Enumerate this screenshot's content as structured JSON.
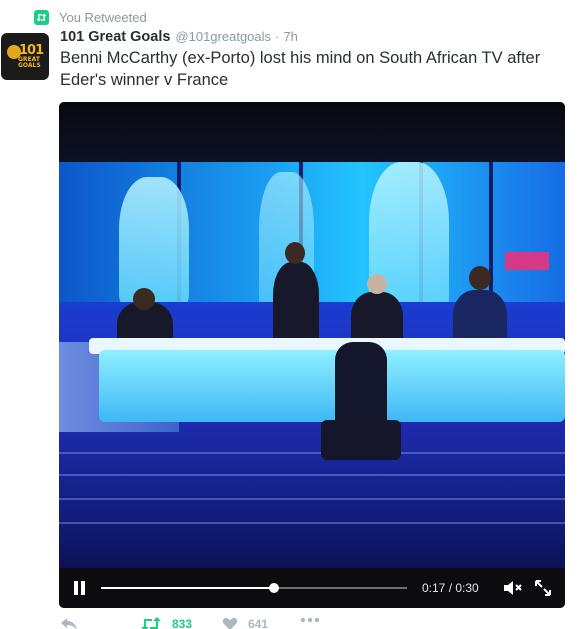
{
  "retweet_context": {
    "label": "You Retweeted",
    "icon": "retweet-icon",
    "color": "#19cf86"
  },
  "author": {
    "avatar_logo_number": "101",
    "avatar_logo_text": "GREAT GOALS",
    "fullname": "101 Great Goals",
    "username": "@101greatgoals",
    "separator": "·",
    "time": "7h"
  },
  "tweet": {
    "text": "Benni McCarthy (ex-Porto) lost his mind on South African TV after Eder's winner v France"
  },
  "video": {
    "state": "playing",
    "current_time": "0:17",
    "duration": "0:30",
    "progress_fraction": 0.566,
    "controls": {
      "pause_icon": "pause-icon",
      "mute_icon": "muted-speaker-icon",
      "fullscreen_icon": "fullscreen-icon"
    }
  },
  "actions": {
    "reply_icon": "reply-icon",
    "retweet_icon": "retweet-icon",
    "retweet_count": "833",
    "like_icon": "heart-icon",
    "like_count": "641",
    "more_icon": "more-icon"
  },
  "colors": {
    "text": "#292f33",
    "muted": "#8899a6",
    "retweet_green": "#19cf86",
    "action_gray": "#aab8c2"
  }
}
